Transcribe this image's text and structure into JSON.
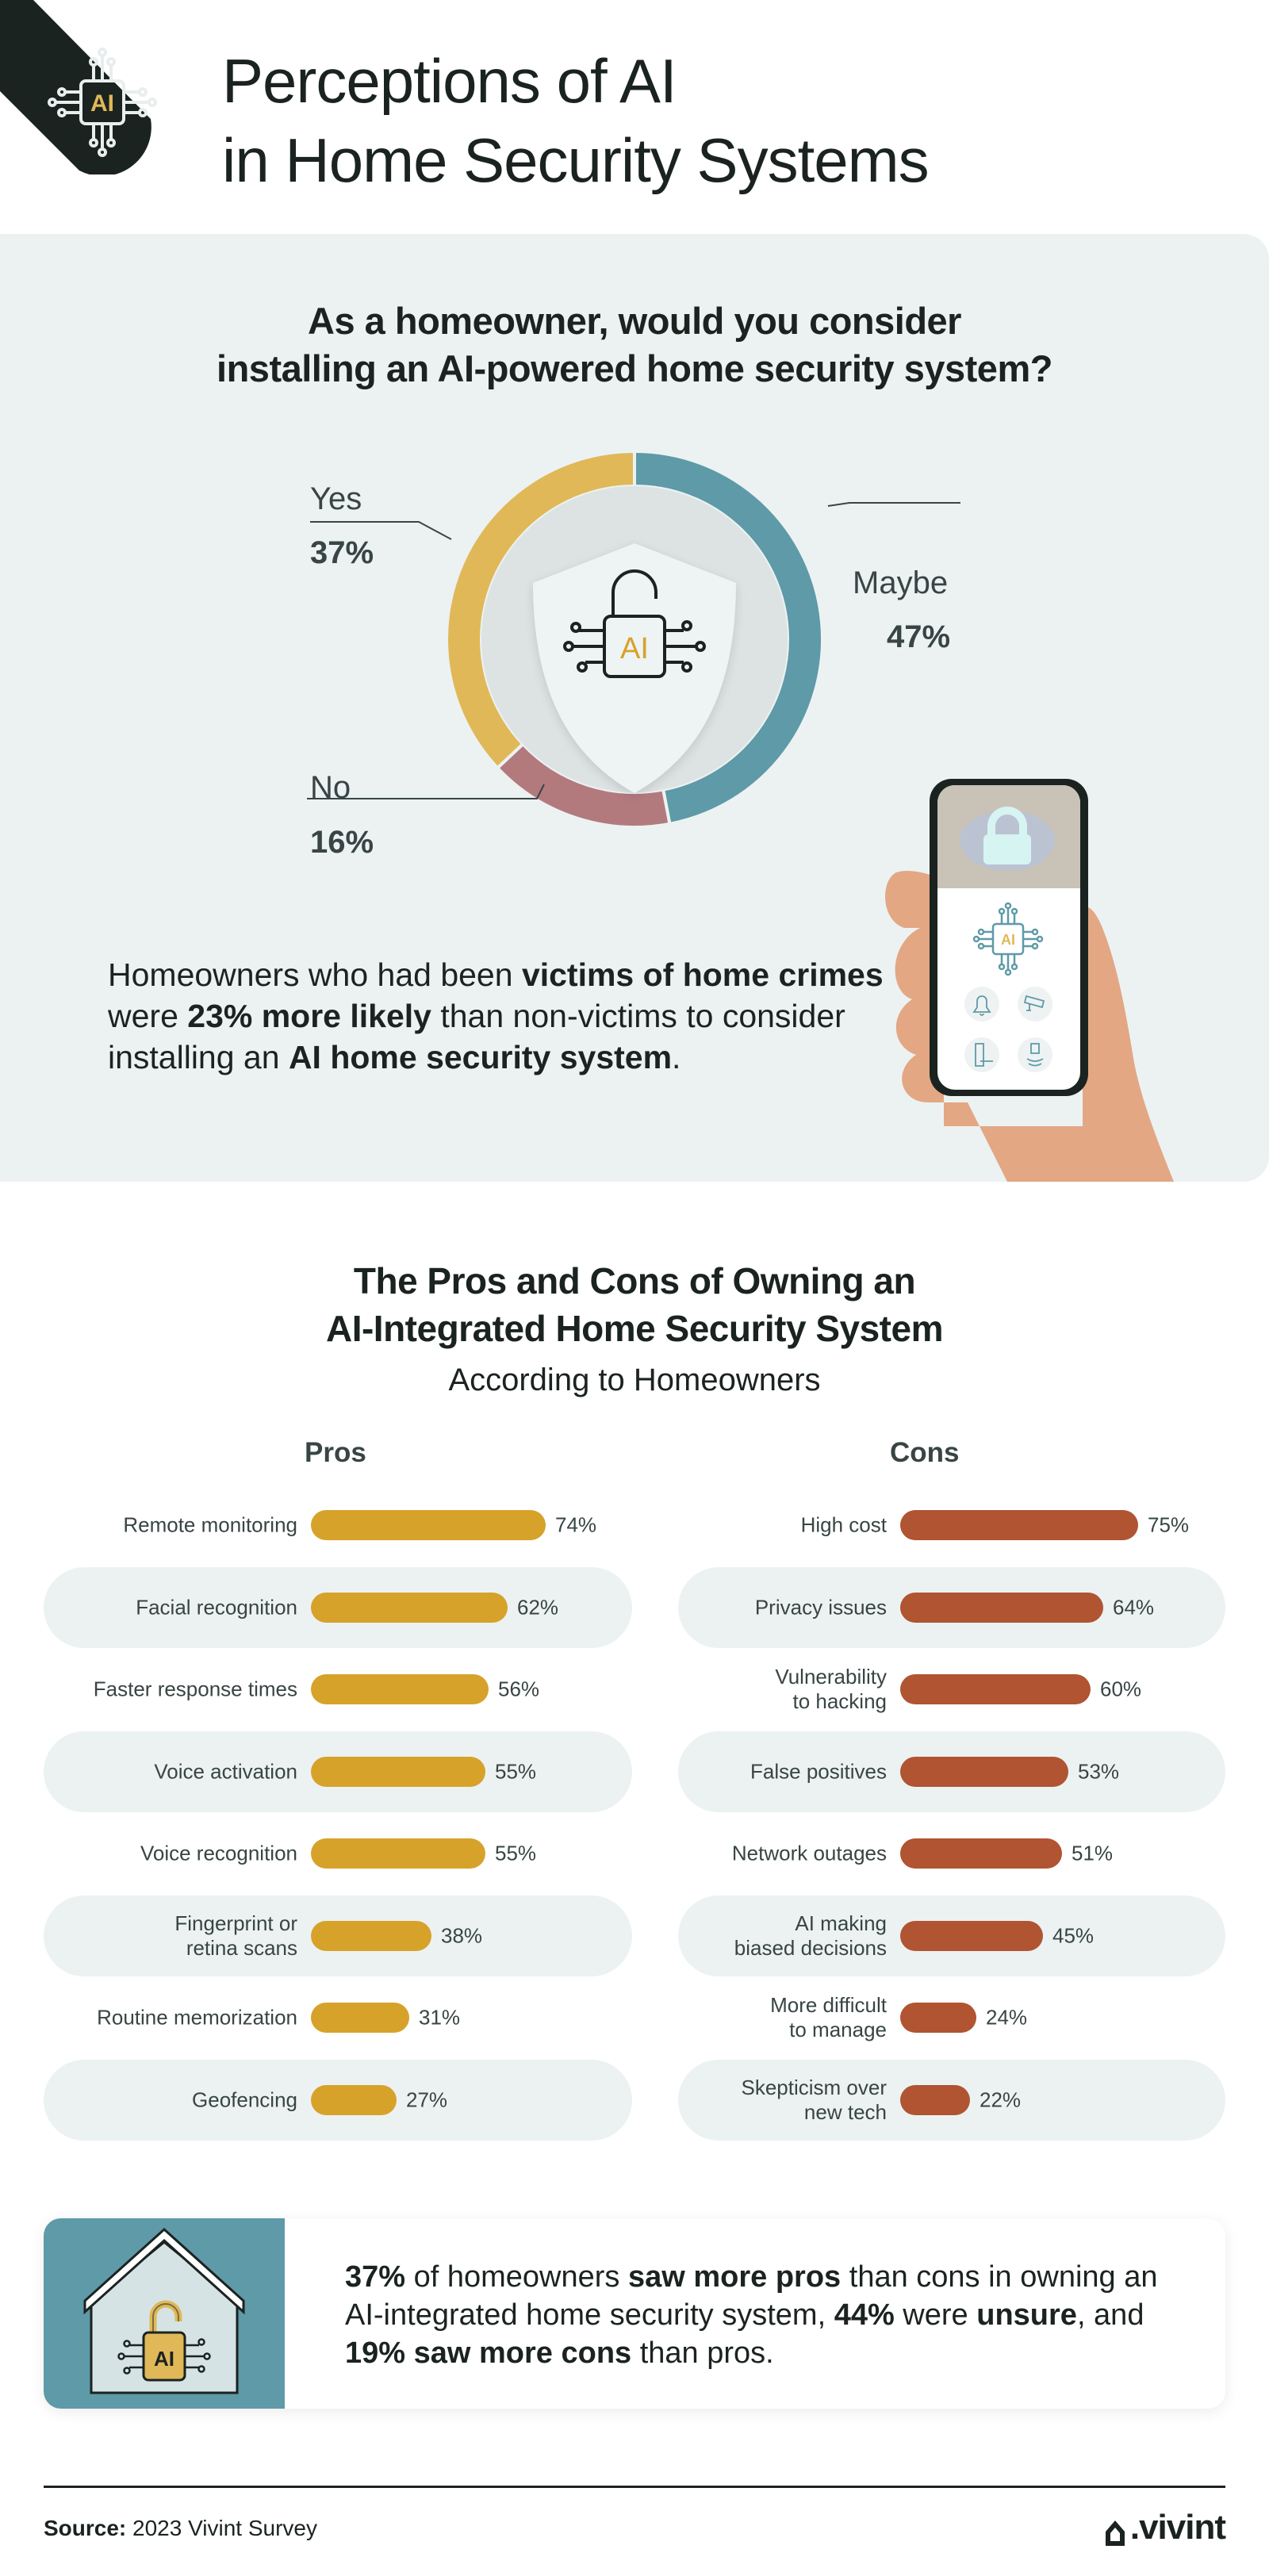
{
  "header": {
    "title_line1": "Perceptions of AI",
    "title_line2": "in Home Security Systems",
    "badge_icon": "ai-chip-icon",
    "badge_text": "AI"
  },
  "question": {
    "line1": "As a homeowner, would you consider",
    "line2": "installing an AI-powered home security system?",
    "center_icon": "ai-padlock-shield-icon",
    "center_text": "AI"
  },
  "stat": {
    "p1": "Homeowners who had been ",
    "b1": "victims of home crimes",
    "p2": " were ",
    "b2": "23% more likely",
    "p3": " than non-victims to consider installing an ",
    "b3": "AI home security system",
    "p4": "."
  },
  "phone": {
    "chip_text": "AI",
    "icons": [
      "bell-icon",
      "security-camera-icon",
      "keypad-lock-icon",
      "doorbell-sensor-icon"
    ]
  },
  "section2": {
    "title_line1": "The Pros and Cons of Owning an",
    "title_line2": "AI-Integrated Home Security System",
    "subtitle": "According to Homeowners",
    "pros_heading": "Pros",
    "cons_heading": "Cons"
  },
  "callout": {
    "icon": "house-ai-lock-icon",
    "icon_text": "AI",
    "b1": "37%",
    "p1": " of homeowners ",
    "b2": "saw more pros",
    "p2": " than cons in owning an AI-integrated home security system, ",
    "b3": "44%",
    "p3": " were ",
    "b4": "unsure",
    "p4": ", and ",
    "b5": "19% saw more cons",
    "p5": " than pros."
  },
  "footer": {
    "source_label": "Source:",
    "source_text": " 2023 Vivint Survey",
    "logo_text": ".vivint"
  },
  "colors": {
    "yes": "#e0b858",
    "maybe": "#5e9aa8",
    "no": "#b37a7e",
    "pros_bar": "#d6a22a",
    "cons_bar": "#b05432",
    "panel_bg": "#ecf2f2",
    "dark": "#1b2321"
  },
  "chart_data": [
    {
      "type": "pie",
      "title": "As a homeowner, would you consider installing an AI-powered home security system?",
      "donut": true,
      "categories": [
        "Maybe",
        "No",
        "Yes"
      ],
      "values": [
        47,
        16,
        37
      ],
      "labels": [
        "47%",
        "16%",
        "37%"
      ],
      "colors": [
        "#5e9aa8",
        "#b37a7e",
        "#e0b858"
      ],
      "start": "top",
      "direction": "clockwise"
    },
    {
      "type": "bar",
      "orientation": "horizontal",
      "title": "Pros",
      "categories": [
        "Remote monitoring",
        "Facial recognition",
        "Faster response times",
        "Voice activation",
        "Voice recognition",
        "Fingerprint or retina scans",
        "Routine memorization",
        "Geofencing"
      ],
      "display_labels": [
        [
          "Remote monitoring"
        ],
        [
          "Facial recognition"
        ],
        [
          "Faster response times"
        ],
        [
          "Voice activation"
        ],
        [
          "Voice recognition"
        ],
        [
          "Fingerprint or",
          "retina scans"
        ],
        [
          "Routine memorization"
        ],
        [
          "Geofencing"
        ]
      ],
      "values": [
        74,
        62,
        56,
        55,
        55,
        38,
        31,
        27
      ],
      "unit": "%",
      "color": "#d6a22a"
    },
    {
      "type": "bar",
      "orientation": "horizontal",
      "title": "Cons",
      "categories": [
        "High cost",
        "Privacy issues",
        "Vulnerability to hacking",
        "False positives",
        "Network outages",
        "AI making biased decisions",
        "More difficult to manage",
        "Skepticism over new tech"
      ],
      "display_labels": [
        [
          "High cost"
        ],
        [
          "Privacy issues"
        ],
        [
          "Vulnerability",
          "to hacking"
        ],
        [
          "False positives"
        ],
        [
          "Network outages"
        ],
        [
          "AI making",
          "biased decisions"
        ],
        [
          "More difficult",
          "to manage"
        ],
        [
          "Skepticism over",
          "new tech"
        ]
      ],
      "values": [
        75,
        64,
        60,
        53,
        51,
        45,
        24,
        22
      ],
      "unit": "%",
      "color": "#b05432"
    }
  ]
}
